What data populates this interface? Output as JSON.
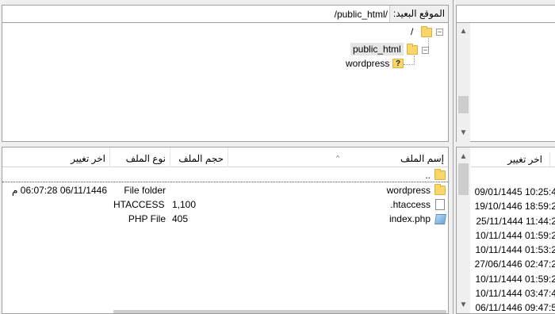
{
  "remote": {
    "path_label": "الموقع البعيد:",
    "path_value": "/public_html/",
    "tree": {
      "root": "/",
      "public_html": "public_html",
      "wordpress": "wordpress"
    },
    "columns": {
      "name": "إسم الملف",
      "size": "حجم الملف",
      "type": "نوع الملف",
      "modified": "اخر تغيير"
    },
    "rows": [
      {
        "name": "..",
        "size": "",
        "type": "",
        "modified": "",
        "icon": "folder-icon"
      },
      {
        "name": "wordpress",
        "size": "",
        "type": "File folder",
        "modified": "06/11/1446 06:07:28 م",
        "icon": "folder-icon"
      },
      {
        "name": ".htaccess",
        "size": "1,100",
        "type": "HTACCESS ...",
        "modified": "",
        "icon": "file-icon"
      },
      {
        "name": "index.php",
        "size": "405",
        "type": "PHP File",
        "modified": "",
        "icon": "php-file-icon"
      }
    ]
  },
  "local": {
    "column_modified": "اخر تغيير",
    "dates": [
      "09/01/1445 10:25:4",
      "19/10/1446 18:59:2",
      "25/11/1444 11:44:2",
      "10/11/1444 01:59:2",
      "10/11/1444 01:53:2",
      "27/06/1446 02:47:2",
      "10/11/1444 01:59:2",
      "10/11/1444 03:47:4",
      "06/11/1446 09:47:5"
    ]
  },
  "colors": {
    "folder": "#f9d66a",
    "selection": "#e5e5e5",
    "border": "#a0a0a0"
  }
}
